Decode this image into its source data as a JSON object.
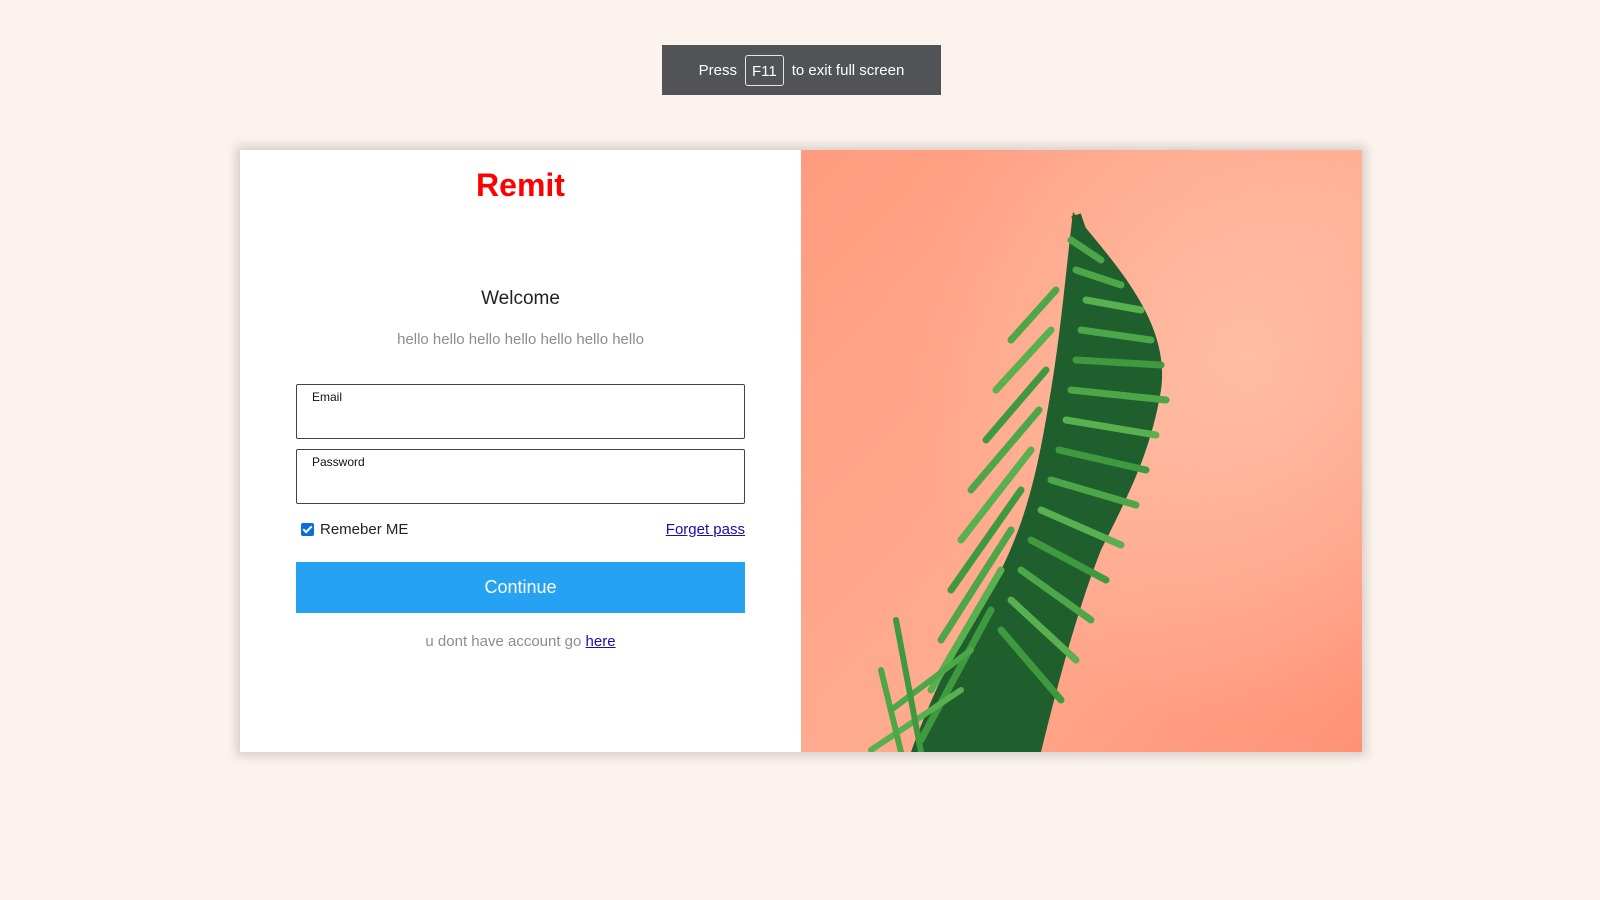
{
  "fullscreen_toast": {
    "prefix": "Press",
    "key": "F11",
    "suffix": "to exit full screen"
  },
  "brand": {
    "name": "Remit",
    "color": "#ff0000"
  },
  "login": {
    "heading": "Welcome",
    "subtitle": "hello hello hello hello hello hello hello",
    "email_label": "Email",
    "email_value": "",
    "password_label": "Password",
    "password_value": "",
    "remember_label": "Remeber ME",
    "remember_checked": true,
    "forgot_link": "Forget pass",
    "continue_label": "Continue",
    "signup_text": "u dont have account go",
    "signup_link": "here"
  },
  "colors": {
    "page_background": "#fdf3ee",
    "button": "#25a3f2",
    "image_background": "#ff9f80",
    "plant": "#2e8a3c"
  },
  "hero_image": {
    "description_icon": "plant-image"
  }
}
